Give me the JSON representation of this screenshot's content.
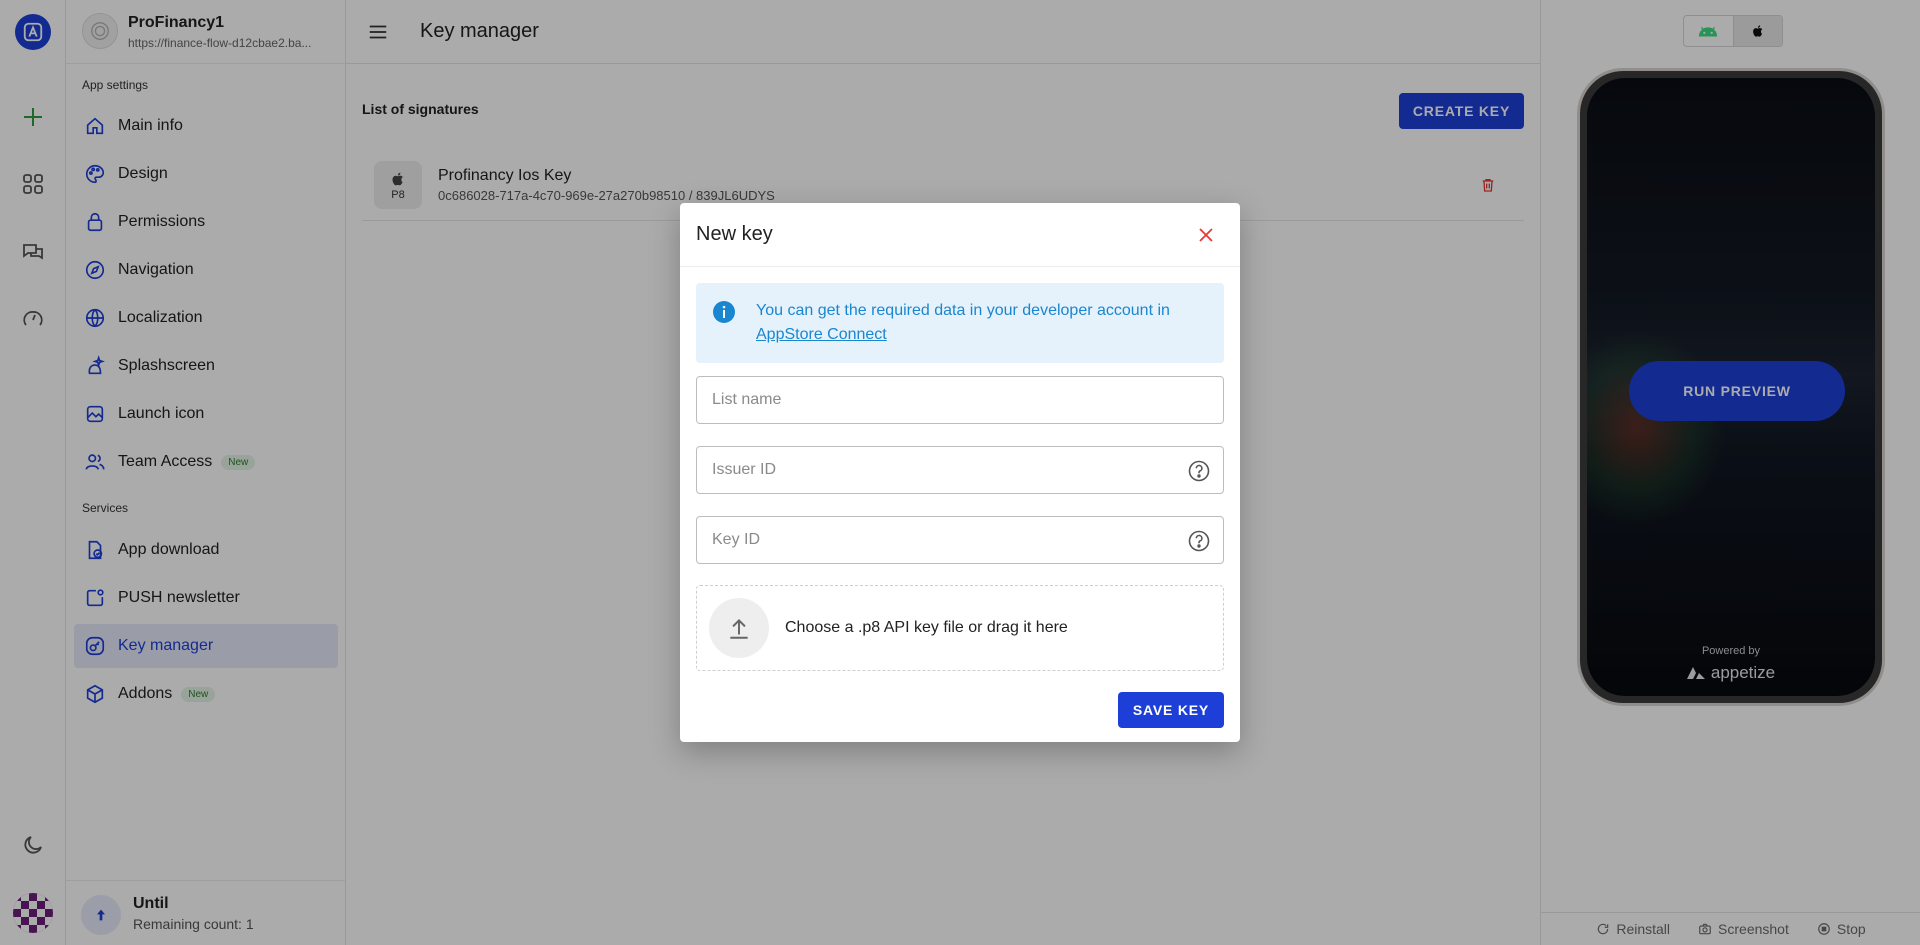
{
  "app": {
    "name": "ProFinancy1",
    "url": "https://finance-flow-d12cbae2.ba..."
  },
  "sidebar": {
    "app_settings_title": "App settings",
    "app_settings": [
      {
        "label": "Main info",
        "icon": "home-icon"
      },
      {
        "label": "Design",
        "icon": "palette-icon"
      },
      {
        "label": "Permissions",
        "icon": "lock-icon"
      },
      {
        "label": "Navigation",
        "icon": "compass-icon"
      },
      {
        "label": "Localization",
        "icon": "globe-icon"
      },
      {
        "label": "Splashscreen",
        "icon": "sparkle-icon"
      },
      {
        "label": "Launch icon",
        "icon": "image-icon"
      },
      {
        "label": "Team Access",
        "icon": "users-icon",
        "badge": "New"
      }
    ],
    "services_title": "Services",
    "services": [
      {
        "label": "App download",
        "icon": "download-check-icon"
      },
      {
        "label": "PUSH newsletter",
        "icon": "notification-icon"
      },
      {
        "label": "Key manager",
        "icon": "key-icon",
        "active": true
      },
      {
        "label": "Addons",
        "icon": "cube-icon",
        "badge": "New"
      }
    ],
    "plan": {
      "title": "Until",
      "subtitle": "Remaining count: 1"
    }
  },
  "main": {
    "page_title": "Key manager",
    "list_title": "List of signatures",
    "create_key_label": "CREATE KEY",
    "keys": [
      {
        "badge": "P8",
        "name": "Profinancy Ios Key",
        "id": "0c686028-717a-4c70-969e-27a270b98510 / 839JL6UDYS"
      }
    ]
  },
  "preview": {
    "run_label": "RUN PREVIEW",
    "powered_by": "Powered by",
    "brand": "appetize",
    "footer": {
      "reinstall": "Reinstall",
      "screenshot": "Screenshot",
      "stop": "Stop"
    }
  },
  "modal": {
    "title": "New key",
    "info_text": "You can get the required data in your developer account in",
    "info_link": "AppStore Connect",
    "list_name_placeholder": "List name",
    "issuer_id_placeholder": "Issuer ID",
    "key_id_placeholder": "Key ID",
    "upload_text": "Choose a .p8 API key file or drag it here",
    "save_label": "SAVE KEY"
  },
  "colors": {
    "accent": "#1d3fd8",
    "info_text": "#1a86d0",
    "info_bg": "#e5f2fc",
    "danger": "#e53935",
    "android_green": "#3ddc84"
  }
}
